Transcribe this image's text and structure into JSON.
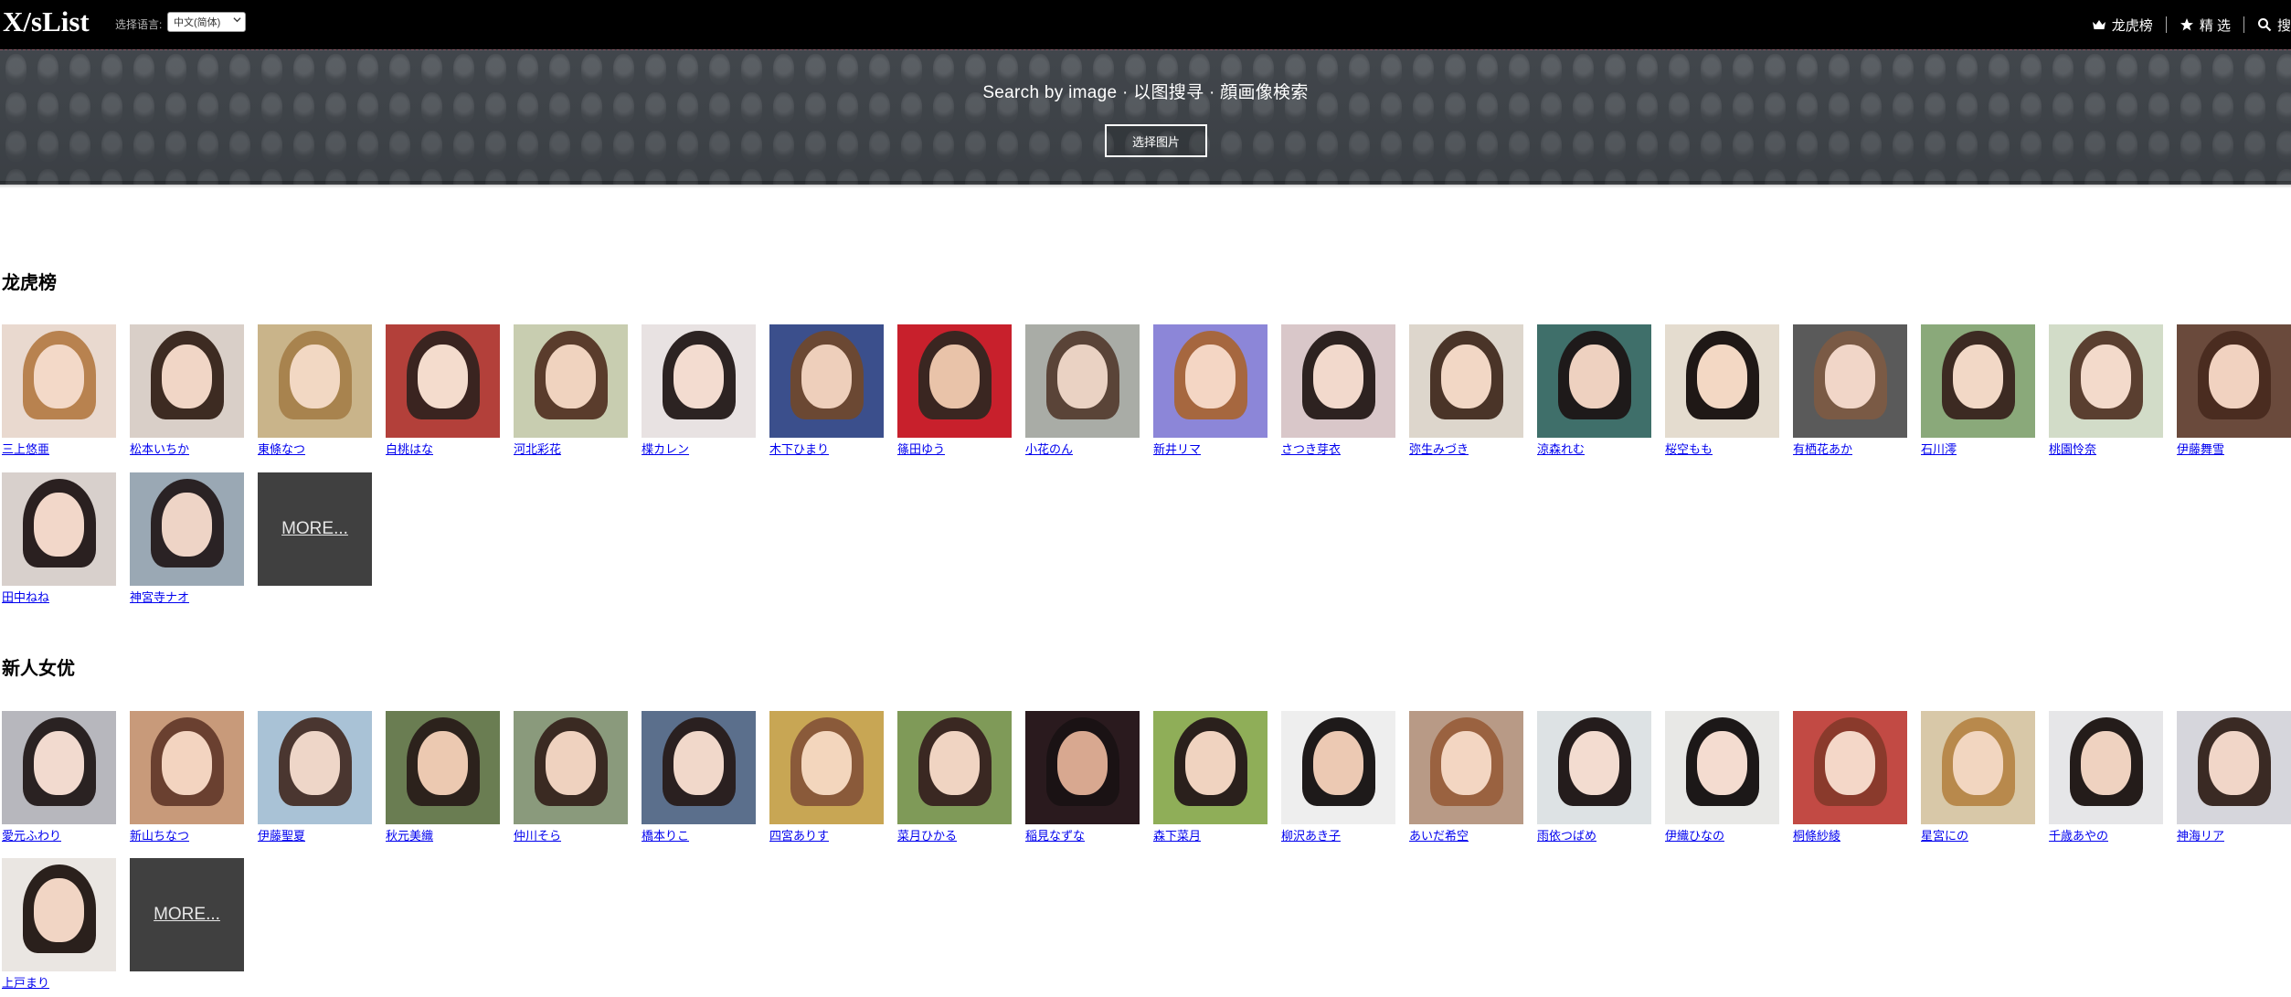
{
  "header": {
    "logo": "X/sList",
    "lang_label": "选择语言:",
    "lang_selected": "中文(简体)",
    "nav": [
      {
        "label": "龙虎榜",
        "icon": "crown-icon"
      },
      {
        "label": "精 选",
        "icon": "star-icon"
      },
      {
        "label": "搜",
        "icon": "search-icon"
      }
    ]
  },
  "banner": {
    "title": "Search by image · 以图搜寻 · 顔画像検索",
    "button": "选择图片"
  },
  "sections": [
    {
      "title": "龙虎榜",
      "more": "MORE...",
      "items": [
        {
          "name": "三上悠亜",
          "bg": "#e9d9cf",
          "hair": "#b8824f",
          "skin": "#f3d9c8"
        },
        {
          "name": "松本いちか",
          "bg": "#d9cfc8",
          "hair": "#3d2b22",
          "skin": "#f1d6c6"
        },
        {
          "name": "東條なつ",
          "bg": "#c9b48a",
          "hair": "#a8834e",
          "skin": "#f2d8c3"
        },
        {
          "name": "白桃はな",
          "bg": "#b3403a",
          "hair": "#3a2420",
          "skin": "#f4dccd"
        },
        {
          "name": "河北彩花",
          "bg": "#c8cdb0",
          "hair": "#5a3c2c",
          "skin": "#f0d3bf"
        },
        {
          "name": "楪カレン",
          "bg": "#e8e2e2",
          "hair": "#2c2322",
          "skin": "#f3dcd0"
        },
        {
          "name": "木下ひまり",
          "bg": "#3b4f8c",
          "hair": "#6b4833",
          "skin": "#eecfbb"
        },
        {
          "name": "篠田ゆう",
          "bg": "#c8202c",
          "hair": "#3a2621",
          "skin": "#e9c3a9"
        },
        {
          "name": "小花のん",
          "bg": "#a9aca6",
          "hair": "#5a4438",
          "skin": "#ead2c3"
        },
        {
          "name": "新井リマ",
          "bg": "#8c86d8",
          "hair": "#a6673f",
          "skin": "#f4d6c4"
        },
        {
          "name": "さつき芽衣",
          "bg": "#d9c7c9",
          "hair": "#2d2220",
          "skin": "#f2d9cc"
        },
        {
          "name": "弥生みづき",
          "bg": "#ddd6cc",
          "hair": "#4a3428",
          "skin": "#f2d7c5"
        },
        {
          "name": "涼森れむ",
          "bg": "#3f6f6a",
          "hair": "#1e1a1a",
          "skin": "#eed1c0"
        },
        {
          "name": "桜空もも",
          "bg": "#e4dccf",
          "hair": "#1f1816",
          "skin": "#f3d8c4"
        },
        {
          "name": "有栖花あか",
          "bg": "#5a5a5a",
          "hair": "#7a5a45",
          "skin": "#f1d6c8"
        },
        {
          "name": "石川澪",
          "bg": "#8aa97a",
          "hair": "#3c2a22",
          "skin": "#f2d8c6"
        },
        {
          "name": "桃園怜奈",
          "bg": "#d2dcc8",
          "hair": "#5a3f30",
          "skin": "#f3dacb"
        },
        {
          "name": "伊藤舞雪",
          "bg": "#6a4a3c",
          "hair": "#4a2c20",
          "skin": "#f1d2c0"
        },
        {
          "name": "田中ねね",
          "bg": "#d8d0cc",
          "hair": "#2a2020",
          "skin": "#f2d7c9"
        },
        {
          "name": "神宮寺ナオ",
          "bg": "#9aa8b4",
          "hair": "#2a2224",
          "skin": "#eed4c6"
        }
      ]
    },
    {
      "title": "新人女优",
      "more": "MORE...",
      "items": [
        {
          "name": "愛元ふわり",
          "bg": "#b7b7bd",
          "hair": "#2a2222",
          "skin": "#f2dacf"
        },
        {
          "name": "新山ちなつ",
          "bg": "#c89a7a",
          "hair": "#6a4030",
          "skin": "#f3d4c0"
        },
        {
          "name": "伊藤聖夏",
          "bg": "#a9c2d6",
          "hair": "#4a3630",
          "skin": "#eed6c8"
        },
        {
          "name": "秋元美織",
          "bg": "#6a7d52",
          "hair": "#2c221c",
          "skin": "#ecc9b1"
        },
        {
          "name": "仲川そら",
          "bg": "#8a9a7c",
          "hair": "#3a2a22",
          "skin": "#efd2bf"
        },
        {
          "name": "橋本りこ",
          "bg": "#5b6f8c",
          "hair": "#2a2020",
          "skin": "#f1d8ca"
        },
        {
          "name": "四宮ありす",
          "bg": "#c8a654",
          "hair": "#8a5a3a",
          "skin": "#f3d6bd"
        },
        {
          "name": "菜月ひかる",
          "bg": "#7f9a58",
          "hair": "#3a2822",
          "skin": "#f0d4c2"
        },
        {
          "name": "稲見なずな",
          "bg": "#2a1a1e",
          "hair": "#1a1214",
          "skin": "#d8a890"
        },
        {
          "name": "森下菜月",
          "bg": "#8fae58",
          "hair": "#2a201c",
          "skin": "#f0d3c0"
        },
        {
          "name": "柳沢あき子",
          "bg": "#eeeeee",
          "hair": "#1e1a1a",
          "skin": "#ecc9b3"
        },
        {
          "name": "あいだ希空",
          "bg": "#b89a86",
          "hair": "#9a6240",
          "skin": "#f3d6c2"
        },
        {
          "name": "雨依つばめ",
          "bg": "#dde2e4",
          "hair": "#241c1c",
          "skin": "#f3dcd0"
        },
        {
          "name": "伊織ひなの",
          "bg": "#e8e8e6",
          "hair": "#1c1818",
          "skin": "#f4dcd0"
        },
        {
          "name": "桐條紗綾",
          "bg": "#c24a44",
          "hair": "#8a3a2c",
          "skin": "#f4d7c8"
        },
        {
          "name": "星宮にの",
          "bg": "#d8c8a8",
          "hair": "#b8894c",
          "skin": "#f2d6c0"
        },
        {
          "name": "千歳あやの",
          "bg": "#e6e6e8",
          "hair": "#241c1a",
          "skin": "#efd2c0"
        },
        {
          "name": "神海リア",
          "bg": "#d6d6dc",
          "hair": "#3a2a24",
          "skin": "#f1d6c8"
        },
        {
          "name": "上戸まり",
          "bg": "#eae6e2",
          "hair": "#2a201c",
          "skin": "#f1d5c4"
        }
      ]
    }
  ]
}
